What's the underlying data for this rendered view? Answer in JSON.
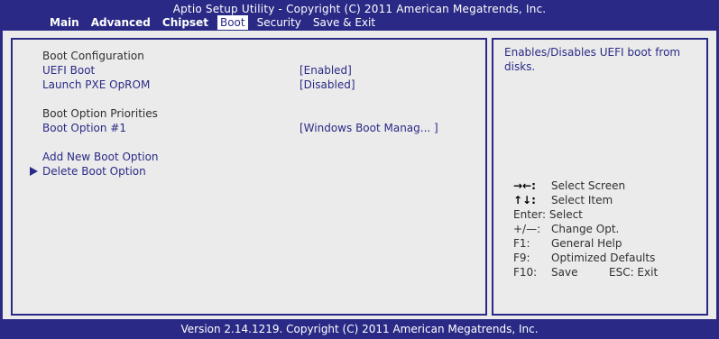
{
  "title": "Aptio Setup Utility - Copyright (C) 2011 American Megatrends, Inc.",
  "tabs": [
    {
      "label": "Main"
    },
    {
      "label": "Advanced"
    },
    {
      "label": "Chipset"
    },
    {
      "label": "Boot"
    },
    {
      "label": "Security"
    },
    {
      "label": "Save & Exit"
    }
  ],
  "active_tab": "Boot",
  "main": {
    "boot_configuration": "Boot Configuration",
    "uefi_boot": {
      "label": "UEFI Boot",
      "value": "[Enabled]"
    },
    "launch_pxe": {
      "label": "Launch PXE OpROM",
      "value": "[Disabled]"
    },
    "boot_option_priorities": "Boot Option Priorities",
    "boot_option_1": {
      "label": "Boot Option #1",
      "value": "[Windows Boot Manag... ]"
    },
    "add_new_boot_option": "Add New Boot Option",
    "delete_boot_option": "Delete Boot Option"
  },
  "help": {
    "description": "Enables/Disables UEFI boot from disks.",
    "keys": {
      "select_screen_key": "→←:",
      "select_screen": "Select Screen",
      "select_item_key": "↑↓:",
      "select_item": "Select Item",
      "enter": "Enter: Select",
      "change_key": "+/—:",
      "change": "Change Opt.",
      "f1_key": "F1:",
      "f1": "General Help",
      "f9_key": "F9:",
      "f9": "Optimized Defaults",
      "f10_key": "F10:",
      "f10": "Save",
      "esc": "ESC: Exit"
    }
  },
  "footer": "Version 2.14.1219. Copyright (C) 2011 American Megatrends, Inc.",
  "colors": {
    "background": "#2a2a86",
    "panel": "#ebebeb",
    "highlight": "#ffffff"
  }
}
